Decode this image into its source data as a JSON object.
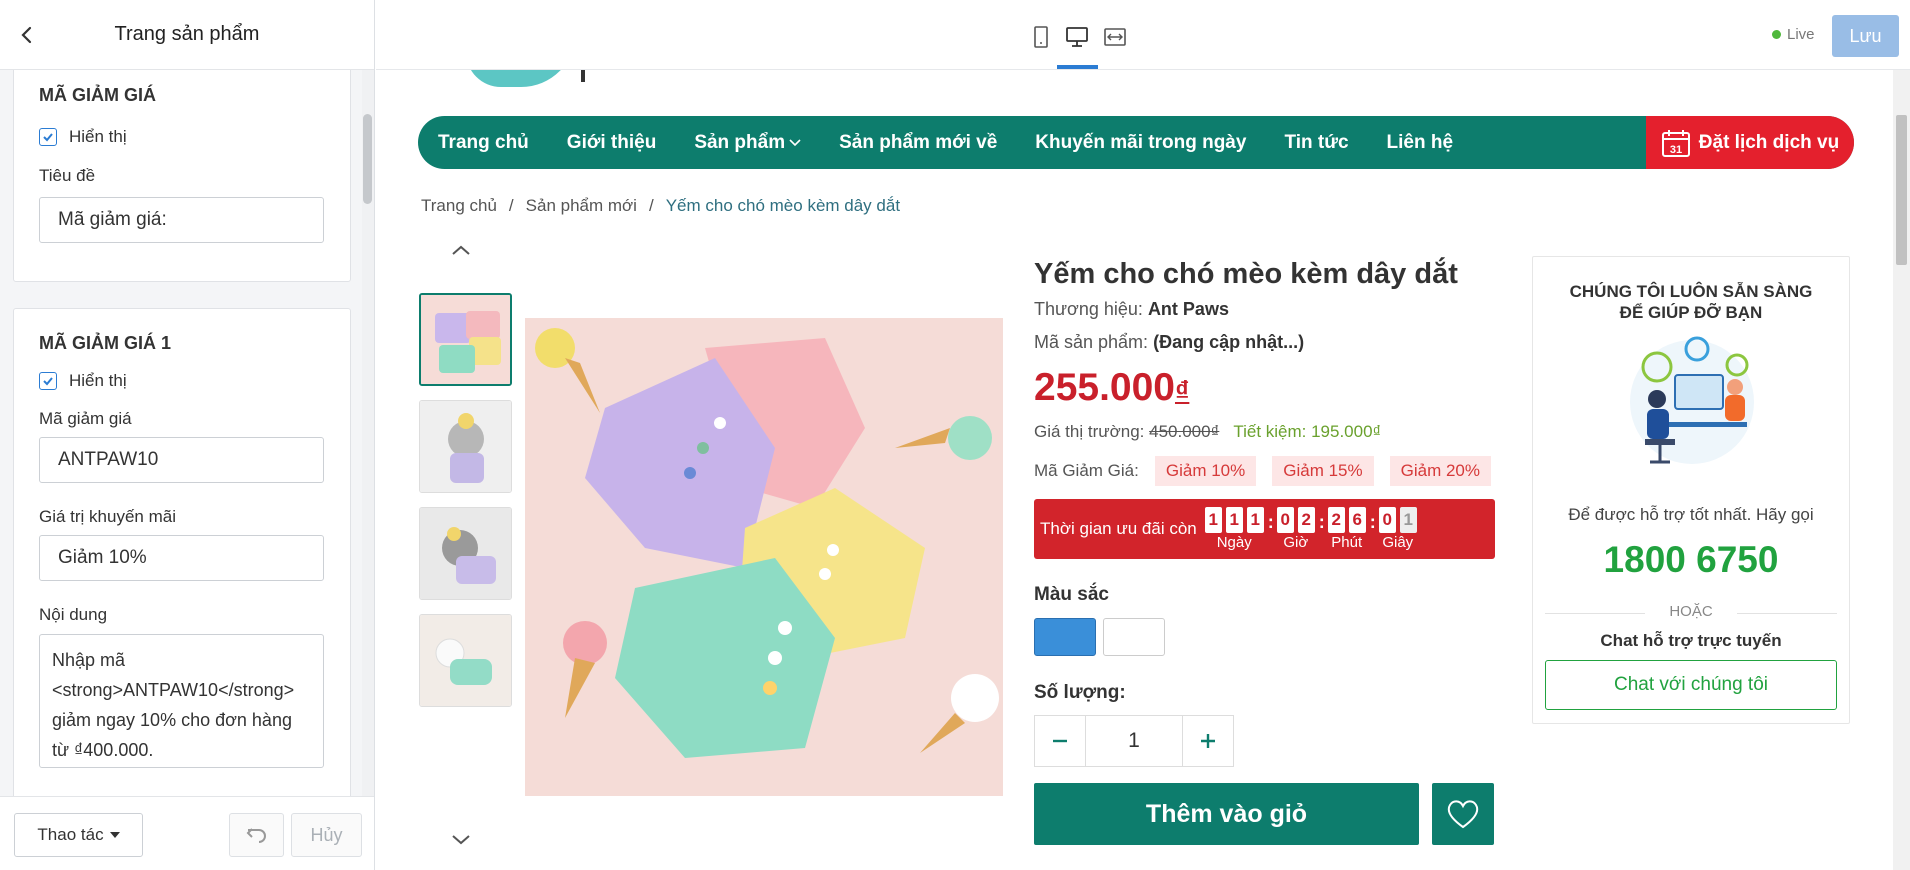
{
  "sidebar": {
    "title": "Trang sản phẩm",
    "section1": {
      "title": "MÃ GIẢM GIÁ",
      "show_label": "Hiển thị",
      "heading_label": "Tiêu đề",
      "heading_value": "Mã giảm giá:"
    },
    "section2": {
      "title": "MÃ GIẢM GIÁ 1",
      "show_label": "Hiển thị",
      "code_label": "Mã giảm giá",
      "code_value": "ANTPAW10",
      "value_label": "Giá trị khuyến mãi",
      "value_value": "Giảm 10%",
      "content_label": "Nội dung",
      "content_value": "Nhập mã <strong>ANTPAW10</strong> giảm ngay 10% cho đơn hàng từ ₫400.000."
    },
    "footer": {
      "action_label": "Thao tác",
      "cancel_label": "Hủy"
    }
  },
  "topbar": {
    "live_label": "Live",
    "save_label": "Lưu"
  },
  "store": {
    "nav": [
      "Trang chủ",
      "Giới thiệu",
      "Sản phẩm",
      "Sản phẩm mới về",
      "Khuyến mãi trong ngày",
      "Tin tức",
      "Liên hệ"
    ],
    "nav_cta": "Đặt lịch dịch vụ",
    "calendar_day": "31",
    "breadcrumb": [
      "Trang chủ",
      "Sản phẩm mới",
      "Yếm cho chó mèo kèm dây dắt"
    ],
    "breadcrumb_sep": "/",
    "product": {
      "title": "Yếm cho chó mèo kèm dây dắt",
      "brand_label": "Thương hiệu:",
      "brand": "Ant Paws",
      "sku_label": "Mã sản phẩm:",
      "sku": "(Đang cập nhật...)",
      "price": "255.000",
      "currency": "₫",
      "market_label": "Giá thị trường:",
      "market_price": "450.000₫",
      "save_text": "Tiết kiệm: 195.000₫",
      "coupon_label": "Mã Giảm Giá:",
      "coupons": [
        "Giảm 10%",
        "Giảm 15%",
        "Giảm 20%"
      ],
      "timer_label": "Thời gian ưu đãi còn",
      "timer": {
        "days": [
          "1",
          "1",
          "1"
        ],
        "hours": [
          "0",
          "2"
        ],
        "minutes": [
          "2",
          "6"
        ],
        "seconds": [
          "0",
          "1"
        ],
        "days_label": "Ngày",
        "hours_label": "Giờ",
        "minutes_label": "Phút",
        "seconds_label": "Giây",
        "colon": ":"
      },
      "color_label": "Màu sắc",
      "colors": [
        "#3a8fd9",
        "#ffffff"
      ],
      "qty_label": "Số lượng:",
      "qty": "1",
      "add_to_cart": "Thêm vào giỏ"
    },
    "support": {
      "title_line1": "CHÚNG TÔI LUÔN SẴN SÀNG",
      "title_line2": "ĐỂ GIÚP ĐỠ BẠN",
      "text": "Để được hỗ trợ tốt nhất. Hãy gọi",
      "phone": "1800 6750",
      "or": "HOẶC",
      "chat_title": "Chat hỗ trợ trực tuyến",
      "chat_button": "Chat với chúng tôi"
    }
  },
  "colors": {
    "primary": "#0d7d6d",
    "accent_red": "#e4202d",
    "price_red": "#c9202b",
    "phone_green": "#21a23f",
    "editor_blue": "#2b7cd3"
  }
}
